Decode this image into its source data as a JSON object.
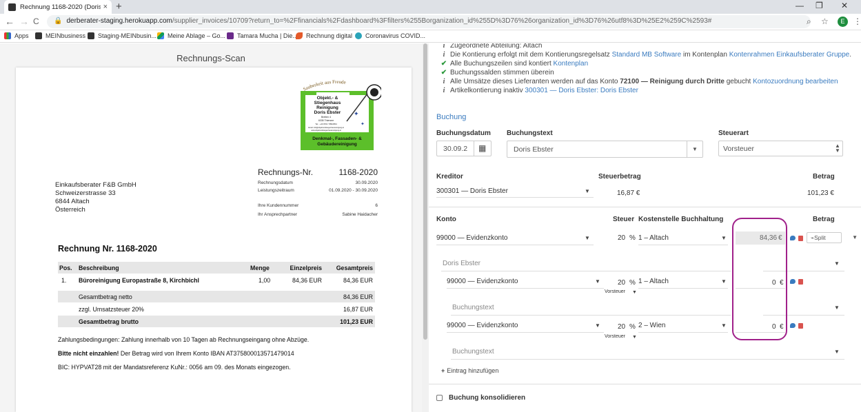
{
  "browser": {
    "tab_title": "Rechnung 1168-2020 (Doris Ebster)",
    "tab_close": "×",
    "new_tab": "+",
    "minimize": "—",
    "restore": "❐",
    "close": "✕",
    "back": "←",
    "forward": "→",
    "reload": "C",
    "url_domain": "derberater-staging.herokuapp.com",
    "url_rest": "/supplier_invoices/10709?return_to=%2Ffinancials%2Fdashboard%3Ffilters%255Borganization_id%255D%3D76%26organization_id%3D76%26utf8%3D%25E2%259C%2593#",
    "avatar_letter": "E",
    "bookmarks": [
      "Apps",
      "MEINbusiness",
      "Staging-MEINbusin...",
      "Meine Ablage – Go...",
      "Tamara Mucha | Die...",
      "Rechnung digital",
      "Coronavirus COVID..."
    ]
  },
  "scan": {
    "title": "Rechnungs-Scan",
    "logo": {
      "arc_text": "Sauberkeit aus Freude",
      "lines": [
        "Objekt.- &",
        "Stiegenhaus",
        "Reinigung",
        "Doris Ebster",
        "Breiten 4",
        "6335 Thiersee",
        "Tel.: +43 650 / 5894654",
        "Email: info@objektundstiegenhausreinigung.at",
        "www.objektundstiegenhausreinigung.at"
      ],
      "bottom": [
        "Denkmal-, Fassaden- &",
        "Gebäudereinigung"
      ]
    },
    "recipient": [
      "Einkaufsberater F&B GmbH",
      "Schweizerstrasse 33",
      "6844 Altach",
      "Österreich"
    ],
    "invoice_label": "Rechnungs-Nr.",
    "invoice_no": "1168-2020",
    "meta": [
      {
        "k": "Rechnungsdatum",
        "v": "30.09.2020"
      },
      {
        "k": "Leistungszeitraum",
        "v": "01.09.2020 - 30.09.2020"
      },
      {
        "k": "Ihre Kundennummer",
        "v": "6"
      },
      {
        "k": "Ihr Ansprechpartner",
        "v": "Sabine Haidacher"
      }
    ],
    "heading": "Rechnung Nr. 1168-2020",
    "columns": [
      "Pos.",
      "Beschreibung",
      "Menge",
      "Einzelpreis",
      "Gesamtpreis"
    ],
    "item": {
      "pos": "1.",
      "desc": "Büroreinigung Europastraße 8, Kirchbichl",
      "qty": "1,00",
      "unit": "84,36 EUR",
      "total": "84,36 EUR"
    },
    "totals": [
      {
        "label": "Gesamtbetrag netto",
        "value": "84,36 EUR"
      },
      {
        "label": "zzgl. Umsatzsteuer 20%",
        "value": "16,87 EUR"
      },
      {
        "label": "Gesamtbetrag brutto",
        "value": "101,23 EUR"
      }
    ],
    "payment": "Zahlungsbedingungen: Zahlung innerhalb von 10 Tagen ab Rechnungseingang ohne Abzüge.",
    "warn_bold": "Bitte nicht einzahlen!",
    "warn_rest": " Der Betrag wird von Ihrem Konto IBAN AT375800013571479014",
    "bic": "BIC: HYPVAT28 mit der Mandatsreferenz KuNr.: 0056 am 09. des Monats eingezogen."
  },
  "booking": {
    "info": [
      {
        "icon": "i",
        "text": "Zugeordnete Abteilung: Altach"
      },
      {
        "icon": "i",
        "t1": "Die Kontierung erfolgt mit dem Kontierungsregelsatz ",
        "l1": "Standard MB Software",
        "t2": " im Kontenplan ",
        "l2": "Kontenrahmen Einkaufsberater Gruppe",
        "t3": "."
      },
      {
        "icon": "✔",
        "t1": "Alle Buchungszeilen sind kontiert ",
        "l1": "Kontenplan"
      },
      {
        "icon": "✔",
        "text": "Buchungssalden stimmen überein"
      },
      {
        "icon": "i",
        "t1": "Alle Umsätze dieses Lieferanten werden auf das Konto ",
        "b1": "72100 — Reinigung durch Dritte",
        "t2": " gebucht ",
        "l1": "Kontozuordnung bearbeiten"
      },
      {
        "icon": "i",
        "t1": "Artikelkontierung inaktiv ",
        "l1": "300301 — Doris Ebster: Doris Ebster"
      }
    ],
    "section_title": "Buchung",
    "labels": {
      "date": "Buchungsdatum",
      "text": "Buchungstext",
      "tax_type": "Steuerart",
      "creditor": "Kreditor",
      "tax_amount": "Steuerbetrag",
      "amount": "Betrag",
      "account": "Konto",
      "tax": "Steuer",
      "cost_center": "Kostenstelle Buchhaltung",
      "amount2": "Betrag"
    },
    "date_value": "30.09.2",
    "text_value": "Doris Ebster",
    "tax_type_value": "Vorsteuer",
    "creditor_value": "300301 — Doris Ebster",
    "tax_amount_value": "16,87 €",
    "amount_value": "101,23 €",
    "line1": {
      "account": "99000 — Evidenzkonto",
      "tax": "20",
      "pct": "%",
      "cost_center": "1 – Altach",
      "amount": "84,36",
      "currency": "€",
      "split": "Split"
    },
    "line1_text": "Doris Ebster",
    "sub1": {
      "account": "99000 — Evidenzkonto",
      "tax": "20",
      "pct": "%",
      "cost_center": "1 – Altach",
      "amount": "0",
      "currency": "€",
      "tax_type": "Vorsteuer",
      "placeholder": "Buchungstext"
    },
    "sub2": {
      "account": "99000 — Evidenzkonto",
      "tax": "20",
      "pct": "%",
      "cost_center": "2 – Wien",
      "amount": "0",
      "currency": "€",
      "tax_type": "Vorsteuer",
      "placeholder": "Buchungstext"
    },
    "add_entry": "Eintrag hinzufügen",
    "consolidate": "Buchung konsolidieren"
  }
}
